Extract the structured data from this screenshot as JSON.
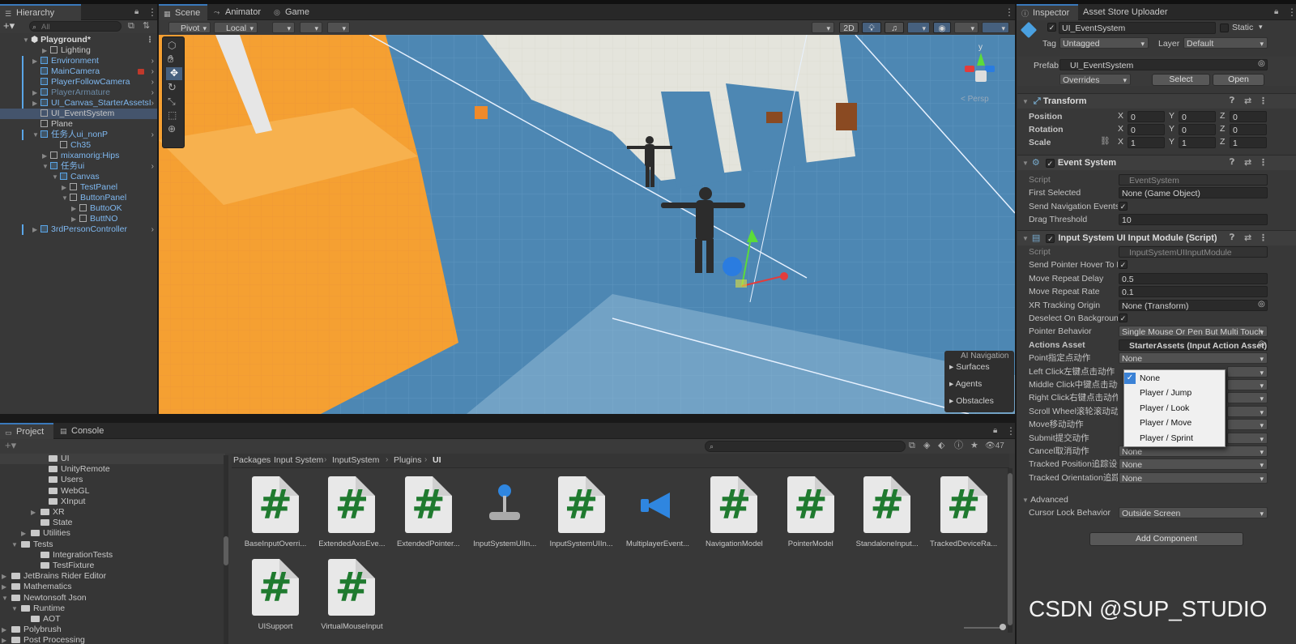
{
  "hierarchy": {
    "tab": "Hierarchy",
    "search_placeholder": "All",
    "scene": "Playground*",
    "items": [
      {
        "label": "Lighting",
        "cls": ""
      },
      {
        "label": "Environment",
        "cls": "blue"
      },
      {
        "label": "MainCamera",
        "cls": "blue"
      },
      {
        "label": "PlayerFollowCamera",
        "cls": "blue"
      },
      {
        "label": "PlayerArmature",
        "cls": "dim"
      },
      {
        "label": "UI_Canvas_StarterAssetsI",
        "cls": "blue"
      },
      {
        "label": "UI_EventSystem",
        "cls": ""
      },
      {
        "label": "Plane",
        "cls": ""
      },
      {
        "label": "任务人ui_nonP",
        "cls": "blue"
      },
      {
        "label": "Ch35",
        "cls": "blue"
      },
      {
        "label": "mixamorig:Hips",
        "cls": "blue"
      },
      {
        "label": "任务ui",
        "cls": "blue"
      },
      {
        "label": "Canvas",
        "cls": "blue"
      },
      {
        "label": "TestPanel",
        "cls": "blue"
      },
      {
        "label": "ButtonPanel",
        "cls": "blue"
      },
      {
        "label": "ButtoOK",
        "cls": "blue"
      },
      {
        "label": "ButtNO",
        "cls": "blue"
      },
      {
        "label": "3rdPersonController",
        "cls": "blue"
      }
    ]
  },
  "scene_view": {
    "tabs": [
      "Scene",
      "Animator",
      "Game"
    ],
    "pivot": "Pivot",
    "local": "Local",
    "mode_2d": "2D",
    "persp": "< Persp",
    "gizmo_y": "y",
    "ai_nav": {
      "title": "AI Navigation",
      "items": [
        "Surfaces",
        "Agents",
        "Obstacles"
      ]
    }
  },
  "inspector": {
    "tabs": [
      "Inspector",
      "Asset Store Uploader"
    ],
    "object_name": "UI_EventSystem",
    "static_label": "Static",
    "tag_label": "Tag",
    "tag_value": "Untagged",
    "layer_label": "Layer",
    "layer_value": "Default",
    "prefab_label": "Prefab",
    "prefab_value": "UI_EventSystem",
    "overrides": "Overrides",
    "select": "Select",
    "open": "Open",
    "transform": {
      "title": "Transform",
      "position": {
        "label": "Position",
        "x": "0",
        "y": "0",
        "z": "0"
      },
      "rotation": {
        "label": "Rotation",
        "x": "0",
        "y": "0",
        "z": "0"
      },
      "scale": {
        "label": "Scale",
        "x": "1",
        "y": "1",
        "z": "1"
      }
    },
    "event_system": {
      "title": "Event System",
      "script_label": "Script",
      "script_value": "EventSystem",
      "first_selected_label": "First Selected",
      "first_selected_value": "None (Game Object)",
      "send_nav_label": "Send Navigation Events",
      "drag_label": "Drag Threshold",
      "drag_value": "10"
    },
    "input_module": {
      "title": "Input System UI Input Module (Script)",
      "rows": [
        {
          "label": "Script",
          "value": "InputSystemUIInputModule"
        },
        {
          "label": "Send Pointer Hover To P",
          "value": ""
        },
        {
          "label": "Move Repeat Delay",
          "value": "0.5"
        },
        {
          "label": "Move Repeat Rate",
          "value": "0.1"
        },
        {
          "label": "XR Tracking Origin",
          "value": "None (Transform)"
        },
        {
          "label": "Deselect On Background",
          "value": ""
        },
        {
          "label": "Pointer Behavior",
          "value": "Single Mouse Or Pen But Multi Touch"
        },
        {
          "label": "Actions Asset",
          "value": "StarterAssets (Input Action Asset)"
        },
        {
          "label": "Point指定点动作",
          "value": "None"
        },
        {
          "label": "Left Click左键点击动作",
          "value": ""
        },
        {
          "label": "Middle Click中键点击动作",
          "value": ""
        },
        {
          "label": "Right Click右键点击动作",
          "value": ""
        },
        {
          "label": "Scroll Wheel滚轮滚动动作",
          "value": ""
        },
        {
          "label": "Move移动动作",
          "value": ""
        },
        {
          "label": "Submit提交动作",
          "value": ""
        },
        {
          "label": "Cancel取消动作",
          "value": "None"
        },
        {
          "label": "Tracked Position追踪设备位置",
          "value": "None"
        },
        {
          "label": "Tracked Orientation追踪设备方向",
          "value": "None"
        }
      ],
      "advanced": "Advanced",
      "cursor_label": "Cursor Lock Behavior",
      "cursor_value": "Outside Screen"
    },
    "add_component": "Add Component",
    "dropdown_options": [
      "None",
      "Player / Jump",
      "Player / Look",
      "Player / Move",
      "Player / Sprint"
    ]
  },
  "project": {
    "tabs": [
      "Project",
      "Console"
    ],
    "count": "47",
    "breadcrumb": [
      "Packages",
      "Input System",
      "InputSystem",
      "Plugins",
      "UI"
    ],
    "tree": [
      {
        "label": "UI",
        "indent": 60,
        "arrow": ""
      },
      {
        "label": "UnityRemote",
        "indent": 60,
        "arrow": ""
      },
      {
        "label": "Users",
        "indent": 60,
        "arrow": ""
      },
      {
        "label": "WebGL",
        "indent": 60,
        "arrow": ""
      },
      {
        "label": "XInput",
        "indent": 60,
        "arrow": ""
      },
      {
        "label": "XR",
        "indent": 50,
        "arrow": "▶"
      },
      {
        "label": "State",
        "indent": 50,
        "arrow": ""
      },
      {
        "label": "Utilities",
        "indent": 38,
        "arrow": "▶"
      },
      {
        "label": "Tests",
        "indent": 26,
        "arrow": "▼"
      },
      {
        "label": "IntegrationTests",
        "indent": 50,
        "arrow": ""
      },
      {
        "label": "TestFixture",
        "indent": 50,
        "arrow": ""
      },
      {
        "label": "JetBrains Rider Editor",
        "indent": 14,
        "arrow": "▶"
      },
      {
        "label": "Mathematics",
        "indent": 14,
        "arrow": "▶"
      },
      {
        "label": "Newtonsoft Json",
        "indent": 14,
        "arrow": "▼"
      },
      {
        "label": "Runtime",
        "indent": 26,
        "arrow": "▼"
      },
      {
        "label": "AOT",
        "indent": 38,
        "arrow": ""
      },
      {
        "label": "Polybrush",
        "indent": 14,
        "arrow": "▶"
      },
      {
        "label": "Post Processing",
        "indent": 14,
        "arrow": "▶"
      }
    ],
    "assets": [
      {
        "label": "BaseInputOverri...",
        "icon": "script"
      },
      {
        "label": "ExtendedAxisEve...",
        "icon": "script"
      },
      {
        "label": "ExtendedPointer...",
        "icon": "script"
      },
      {
        "label": "InputSystemUIIn...",
        "icon": "joystick"
      },
      {
        "label": "InputSystemUIIn...",
        "icon": "script"
      },
      {
        "label": "MultiplayerEvent...",
        "icon": "megaphone"
      },
      {
        "label": "NavigationModel",
        "icon": "script"
      },
      {
        "label": "PointerModel",
        "icon": "script"
      },
      {
        "label": "StandaloneInput...",
        "icon": "script"
      },
      {
        "label": "TrackedDeviceRa...",
        "icon": "script"
      },
      {
        "label": "UISupport",
        "icon": "script"
      },
      {
        "label": "VirtualMouseInput",
        "icon": "script"
      }
    ]
  },
  "watermark": "CSDN @SUP_STUDIO"
}
